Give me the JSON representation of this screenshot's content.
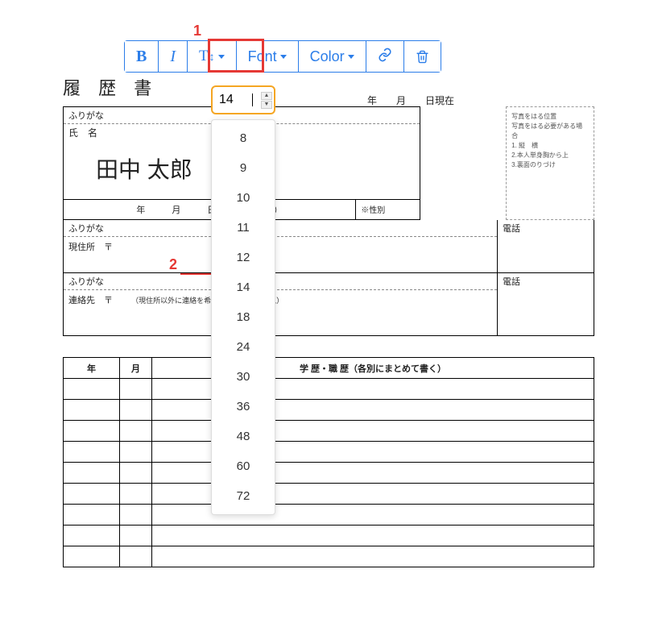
{
  "callouts": {
    "one": "1",
    "two": "2"
  },
  "toolbar": {
    "bold": "B",
    "italic": "I",
    "size_label": "T",
    "font_label": "Font",
    "color_label": "Color"
  },
  "size_input_value": "14",
  "size_options": [
    "8",
    "9",
    "10",
    "11",
    "12",
    "14",
    "18",
    "24",
    "30",
    "36",
    "48",
    "60",
    "72"
  ],
  "doc": {
    "title": "履 歴 書",
    "date_header": "年　　月　　日現在",
    "furigana": "ふりがな",
    "name_label": "氏　名",
    "name_value": "田中 太郎",
    "dob_text": "年　　　月　　　日生　（満　　歳）",
    "gender_label": "※性別",
    "addr_label": "現住所　〒",
    "contact_label": "連絡先　〒",
    "contact_note": "（現住所以外に連絡を希望する場合のみ記入）",
    "tel_label": "電話",
    "photo_note": {
      "l1": "写真をはる位置",
      "l2": "写真をはる必要がある場合",
      "l3": "1. 縦　横",
      "l4": "2.本人単身胸から上",
      "l5": "3.裏面のりづけ"
    },
    "history": {
      "col_year": "年",
      "col_month": "月",
      "col_content": "学 歴・職 歴（各別にまとめて書く）"
    }
  }
}
